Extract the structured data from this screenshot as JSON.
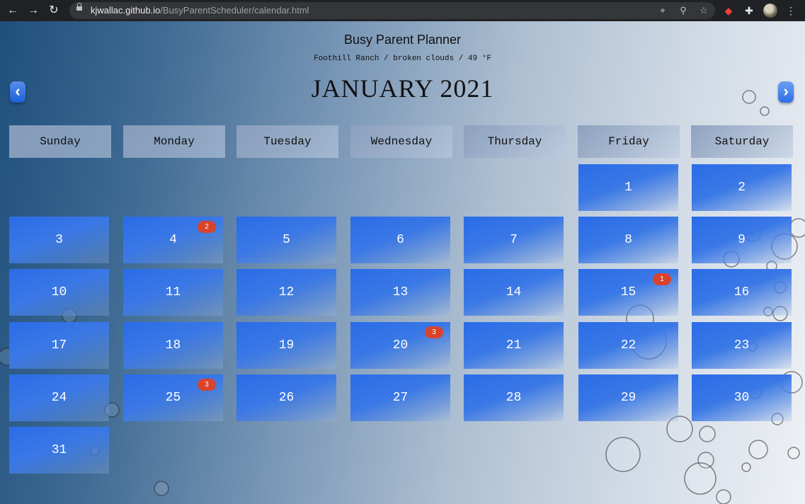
{
  "browser": {
    "url_host": "kjwallac.github.io",
    "url_path": "/BusyParentScheduler/calendar.html"
  },
  "header": {
    "title": "Busy Parent Planner",
    "weather": "Foothill Ranch / broken clouds / 49 °F",
    "month": "JANUARY 2021",
    "prev_label": "‹",
    "next_label": "›"
  },
  "weekdays": [
    "Sunday",
    "Monday",
    "Tuesday",
    "Wednesday",
    "Thursday",
    "Friday",
    "Saturday"
  ],
  "days": [
    {
      "label": "1"
    },
    {
      "label": "2"
    },
    {
      "label": "3"
    },
    {
      "label": "4",
      "badge": "2"
    },
    {
      "label": "5"
    },
    {
      "label": "6"
    },
    {
      "label": "7"
    },
    {
      "label": "8"
    },
    {
      "label": "9"
    },
    {
      "label": "10"
    },
    {
      "label": "11"
    },
    {
      "label": "12"
    },
    {
      "label": "13"
    },
    {
      "label": "14"
    },
    {
      "label": "15",
      "badge": "1"
    },
    {
      "label": "16"
    },
    {
      "label": "17"
    },
    {
      "label": "18"
    },
    {
      "label": "19"
    },
    {
      "label": "20",
      "badge": "3"
    },
    {
      "label": "21"
    },
    {
      "label": "22"
    },
    {
      "label": "23"
    },
    {
      "label": "24"
    },
    {
      "label": "25",
      "badge": "3"
    },
    {
      "label": "26"
    },
    {
      "label": "27"
    },
    {
      "label": "28"
    },
    {
      "label": "29"
    },
    {
      "label": "30"
    },
    {
      "label": "31"
    }
  ],
  "colors": {
    "day_tile": "#2a6ce8",
    "badge": "#d8432c"
  }
}
